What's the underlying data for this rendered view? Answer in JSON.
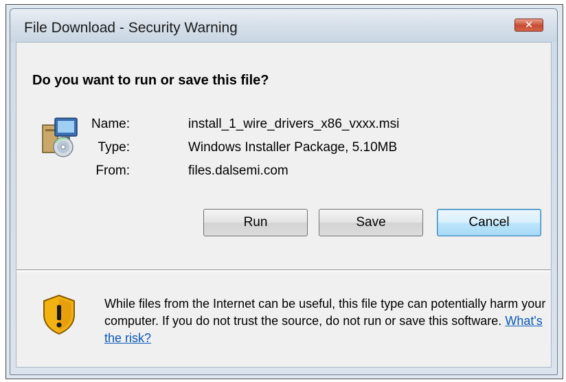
{
  "window": {
    "title": "File Download - Security Warning",
    "close_glyph": "✕"
  },
  "prompt": {
    "question": "Do you want to run or save this file?"
  },
  "file": {
    "name_label": "Name:",
    "name_value": "install_1_wire_drivers_x86_vxxx.msi",
    "type_label": "Type:",
    "type_value": "Windows Installer Package, 5.10MB",
    "from_label": "From:",
    "from_value": "files.dalsemi.com",
    "icon": "installer-package-icon"
  },
  "buttons": {
    "run": "Run",
    "save": "Save",
    "cancel": "Cancel"
  },
  "warning": {
    "icon": "security-shield-warning-icon",
    "text": "While files from the Internet can be useful, this file type can potentially harm your computer. If you do not trust the source, do not run or save this software.",
    "link": "What's the risk?"
  },
  "colors": {
    "link": "#0a58b8",
    "close_button": "#c64a31",
    "default_button_border": "#3c7fb1"
  }
}
